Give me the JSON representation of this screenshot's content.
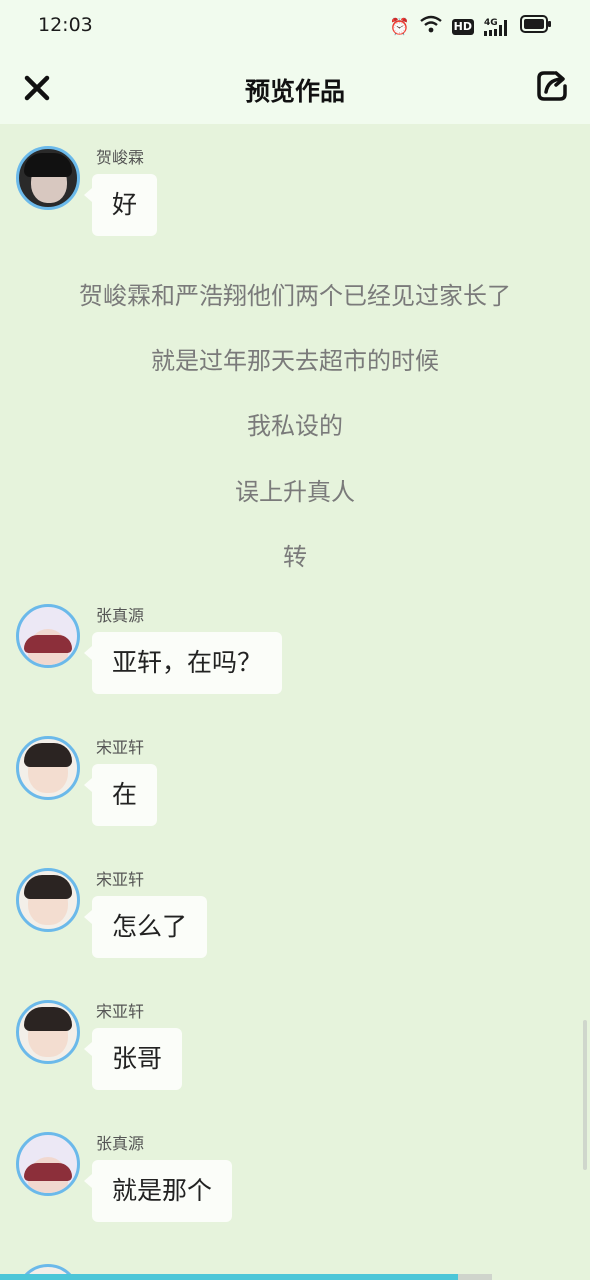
{
  "status_bar": {
    "time": "12:03",
    "icons": [
      "alarm-icon",
      "wifi-icon",
      "hd-icon",
      "signal-4g-icon",
      "battery-icon"
    ],
    "hd_label": "HD",
    "network_label": "4G"
  },
  "header": {
    "title": "预览作品",
    "close_icon": "close-icon",
    "share_icon": "share-icon"
  },
  "messages": [
    {
      "sender": "贺峻霖",
      "text": "好"
    },
    {
      "sender": "张真源",
      "text": "亚轩，在吗？"
    },
    {
      "sender": "宋亚轩",
      "text": "在"
    },
    {
      "sender": "宋亚轩",
      "text": "怎么了"
    },
    {
      "sender": "宋亚轩",
      "text": "张哥"
    },
    {
      "sender": "张真源",
      "text": "就是那个"
    }
  ],
  "narration": [
    "贺峻霖和严浩翔他们两个已经见过家长了",
    "就是过年那天去超市的时候",
    "我私设的",
    "误上升真人",
    "转"
  ],
  "colors": {
    "background": "#e6f3dc",
    "header_bg": "#f1fbee",
    "avatar_border": "#6bb9ea",
    "progress": "#4cc6d8"
  },
  "reading_progress": 0.93
}
